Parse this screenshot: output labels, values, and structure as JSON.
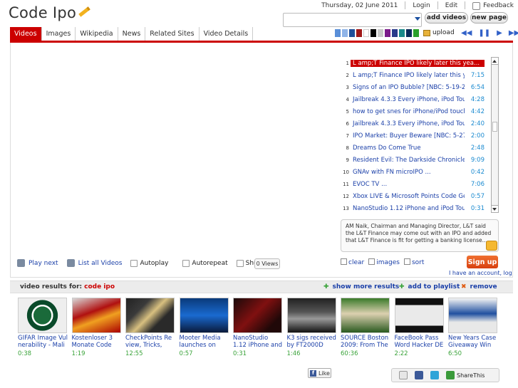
{
  "app": {
    "title": "Code Ipo"
  },
  "topbar": {
    "date": "Thursday, 02 June 2011",
    "login": "Login",
    "edit": "Edit",
    "feedback": "Feedback"
  },
  "search": {
    "value": "",
    "add_videos": "add videos",
    "new_page": "new page"
  },
  "tabs": [
    "Videos",
    "Images",
    "Wikipedia",
    "News",
    "Related Sites",
    "Video Details"
  ],
  "active_tab": "Videos",
  "colors": {
    "accent": "#cc0000",
    "link": "#1a3fa8",
    "duration": "#3aa33a",
    "swatches": [
      "#5a8fd8",
      "#8fb4e8",
      "#1f4f99",
      "#a01818",
      "#ffffff",
      "#000000",
      "#c8c8c8",
      "#7a1a8a",
      "#2a3a8a",
      "#1a8a8a",
      "#0a2a5a",
      "#2aa02a"
    ]
  },
  "upload_label": "upload",
  "player_controls": [
    "rewind-icon",
    "pause-icon",
    "play-icon",
    "forward-icon"
  ],
  "playlist": [
    {
      "n": "1",
      "title": "L amp;T Finance IPO likely later this yea...",
      "dur": "5:03",
      "active": true
    },
    {
      "n": "2",
      "title": "L amp;T Finance IPO likely later this yea...",
      "dur": "7:15"
    },
    {
      "n": "3",
      "title": "Signs of an IPO Bubble? [NBC: 5-19-20...",
      "dur": "6:54"
    },
    {
      "n": "4",
      "title": "Jailbreak 4.3.3 Every iPhone, iPod Touc...",
      "dur": "4:28"
    },
    {
      "n": "5",
      "title": "how to get snes for iPhone/iPod touch ...",
      "dur": "4:42"
    },
    {
      "n": "6",
      "title": "Jailbreak 4.3.3 Every iPhone, iPod Touc...",
      "dur": "2:40"
    },
    {
      "n": "7",
      "title": "IPO Market: Buyer Beware [NBC: 5-27-2...",
      "dur": "2:00"
    },
    {
      "n": "8",
      "title": "Dreams Do Come True",
      "dur": "2:48"
    },
    {
      "n": "9",
      "title": "Resident Evil: The Darkside Chronicles ...",
      "dur": "9:09"
    },
    {
      "n": "10",
      "title": "GNAv with FN microIPO ...",
      "dur": "0:42"
    },
    {
      "n": "11",
      "title": "EVOC TV ...",
      "dur": "7:06"
    },
    {
      "n": "12",
      "title": "Xbox LIVE & Microsoft Points Code Gen...",
      "dur": "0:57"
    },
    {
      "n": "13",
      "title": "NanoStudio 1.12 iPhone and iPod Touc...",
      "dur": "0:31"
    }
  ],
  "description": "AM Naik, Chairman and Managing Director, L&T said the L&T Finance may come out with an IPO and added that L&T Finance is fit for getting a banking license....",
  "toggles": {
    "clear": "clear",
    "images": "images",
    "sort": "sort"
  },
  "signup": "Sign up",
  "have_account": "I have an account, log",
  "controls": {
    "play_next": "Play next",
    "list_all": "List all Videos",
    "autoplay": "Autoplay",
    "autorepeat": "Autorepeat",
    "shuffle": "Shuffle",
    "views": "0 Views"
  },
  "results": {
    "label": "video results for:",
    "query": "code ipo",
    "show_more": "show more results",
    "add_to_playlist": "add to playlist",
    "remove": "remove"
  },
  "videos": [
    {
      "title": "GIFAR Image Vul nerability - Mali",
      "dur": "0:38"
    },
    {
      "title": "Kostenloser 3 Monate Code",
      "dur": "1:19"
    },
    {
      "title": "CheckPoints Re view, Tricks, and",
      "dur": "12:55"
    },
    {
      "title": "Mooter Media launches on",
      "dur": "0:57"
    },
    {
      "title": "NanoStudio 1.12 iPhone and iPod",
      "dur": "0:31"
    },
    {
      "title": "K3 sigs received by FT2000D",
      "dur": "1:46"
    },
    {
      "title": "SOURCE Boston 2009: From The",
      "dur": "60:36"
    },
    {
      "title": "FaceBook Pass Word Hacker DE",
      "dur": "2:22"
    },
    {
      "title": "New Years Case Giveaway Win",
      "dur": "6:50"
    }
  ],
  "footer": {
    "like": "Like",
    "share_this": "ShareThis"
  }
}
